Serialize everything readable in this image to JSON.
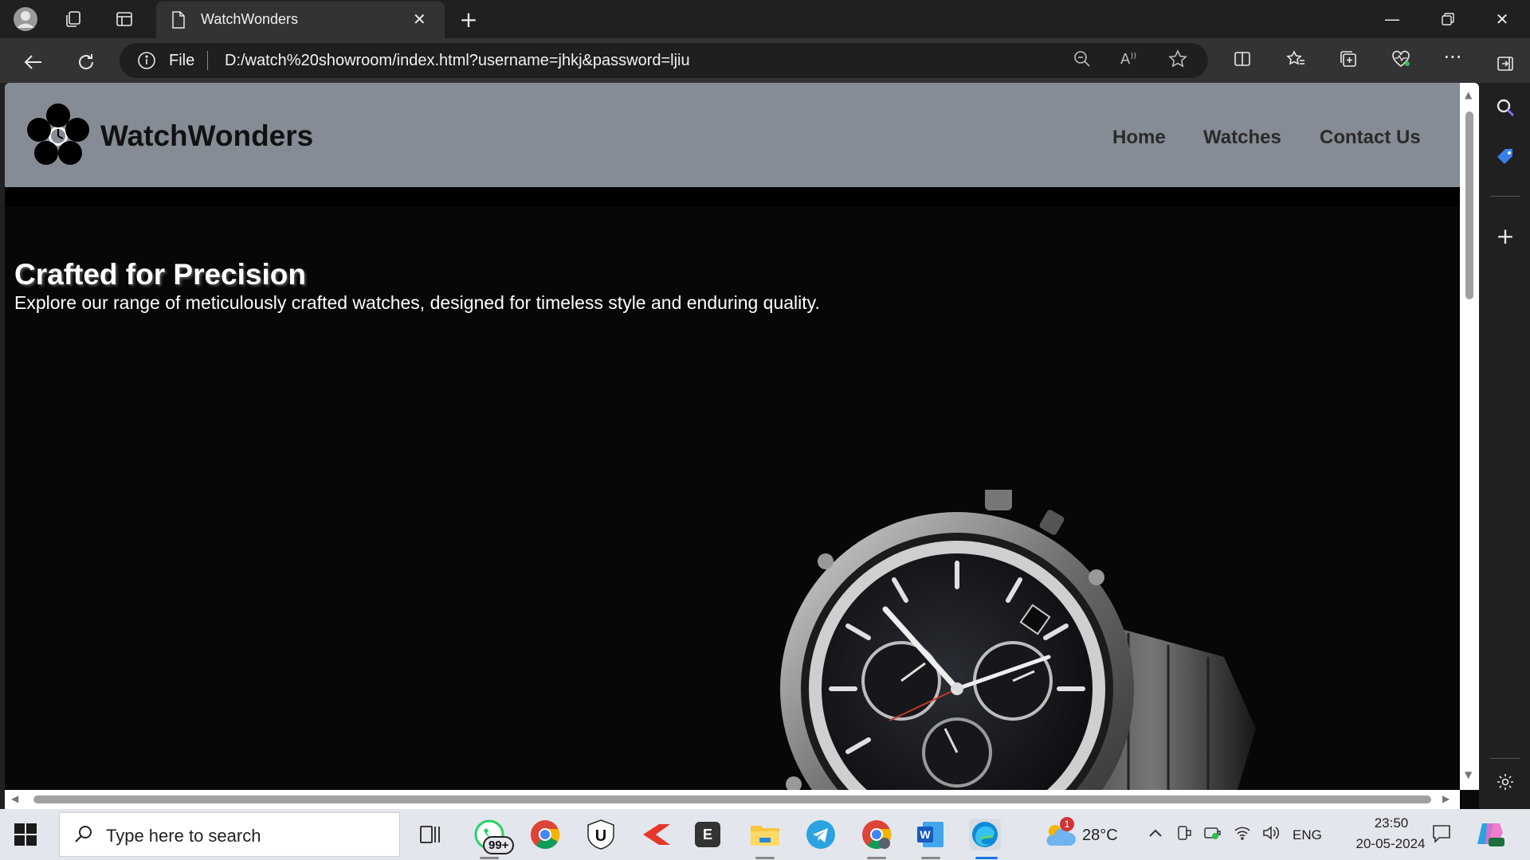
{
  "browser": {
    "tab_title": "WatchWonders",
    "omnibox_scheme_label": "File",
    "url": "D:/watch%20showroom/index.html?username=jhkj&password=ljiu"
  },
  "site": {
    "brand": "WatchWonders",
    "nav": [
      {
        "label": "Home"
      },
      {
        "label": "Watches"
      },
      {
        "label": "Contact Us"
      }
    ],
    "hero": {
      "title": "Crafted for Precision",
      "subtitle": "Explore our range of meticulously crafted watches, designed for timeless style and enduring quality."
    }
  },
  "taskbar": {
    "search_placeholder": "Type here to search",
    "whatsapp_badge": "99+",
    "weather_badge": "1",
    "temperature": "28°C",
    "language": "ENG",
    "time": "23:50",
    "date": "20-05-2024",
    "word_letter": "W",
    "epic_letter": "E",
    "ublock_letter": "U"
  },
  "colors": {
    "site_header_bg": "#858c95",
    "hero_bg": "#000000",
    "taskbar_bg": "#e4e6ed",
    "browser_chrome": "#202020"
  }
}
